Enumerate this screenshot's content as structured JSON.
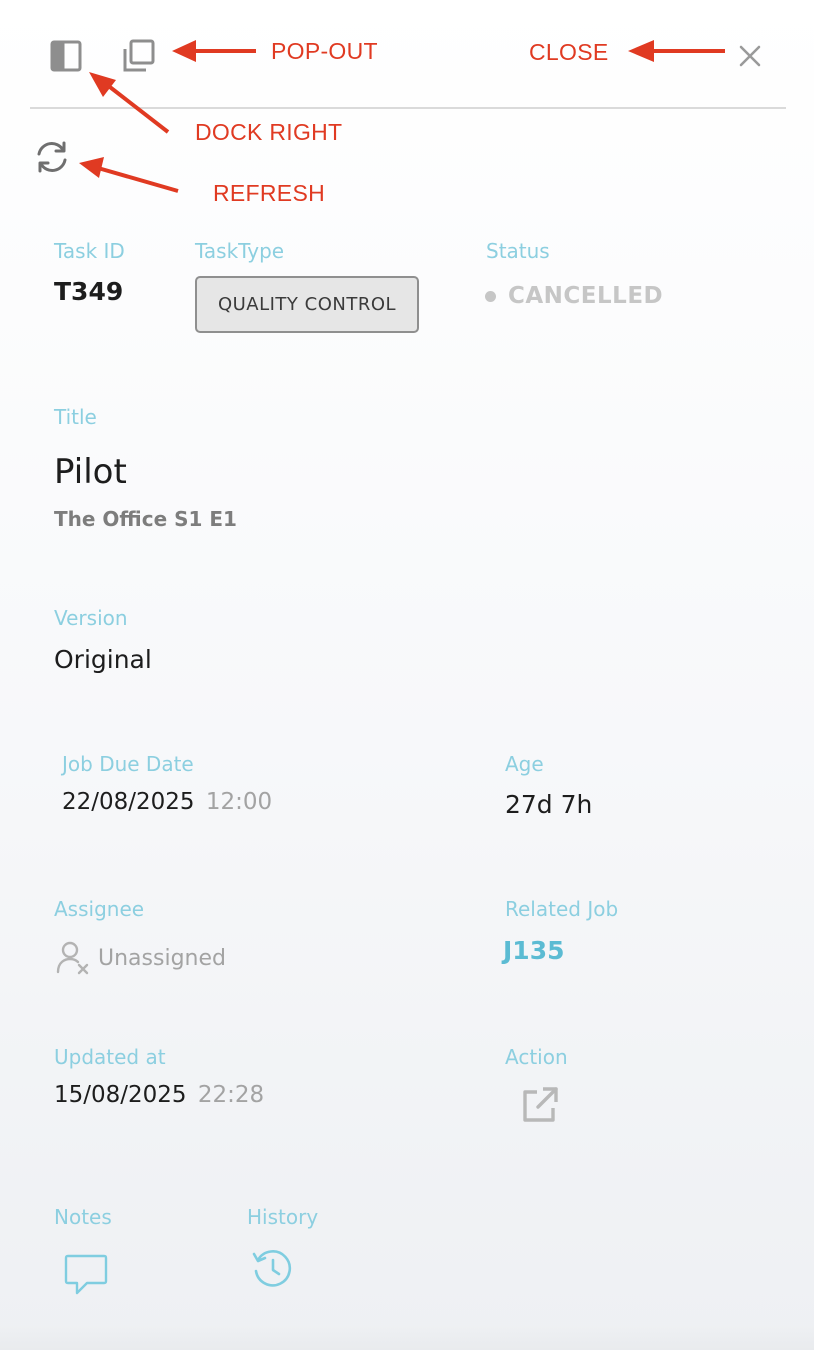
{
  "annotations": {
    "pop_out": "POP-OUT",
    "close": "CLOSE",
    "dock_right": "DOCK RIGHT",
    "refresh": "REFRESH"
  },
  "toolbar": {
    "icons": [
      "dock-right-icon",
      "pop-out-icon",
      "close-icon",
      "refresh-icon"
    ]
  },
  "task": {
    "id_label": "Task ID",
    "id_value": "T349",
    "type_label": "TaskType",
    "type_value": "QUALITY CONTROL",
    "status_label": "Status",
    "status_value": "CANCELLED"
  },
  "title": {
    "label": "Title",
    "value": "Pilot",
    "subtitle": "The Office S1 E1"
  },
  "version": {
    "label": "Version",
    "value": "Original"
  },
  "job_due": {
    "label": "Job Due Date",
    "date": "22/08/2025",
    "time": "12:00"
  },
  "age": {
    "label": "Age",
    "value": "27d 7h"
  },
  "assignee": {
    "label": "Assignee",
    "value": "Unassigned"
  },
  "related_job": {
    "label": "Related Job",
    "value": "J135"
  },
  "updated": {
    "label": "Updated at",
    "date": "15/08/2025",
    "time": "22:28"
  },
  "action": {
    "label": "Action",
    "icon": "external-link-icon"
  },
  "notes": {
    "label": "Notes",
    "icon": "speech-bubble-icon"
  },
  "history": {
    "label": "History",
    "icon": "history-clock-icon"
  },
  "colors": {
    "annotation": "#e03a22",
    "label": "#8ccfe0",
    "link": "#5bbbd3",
    "status_dot": "#c6c6c6"
  }
}
